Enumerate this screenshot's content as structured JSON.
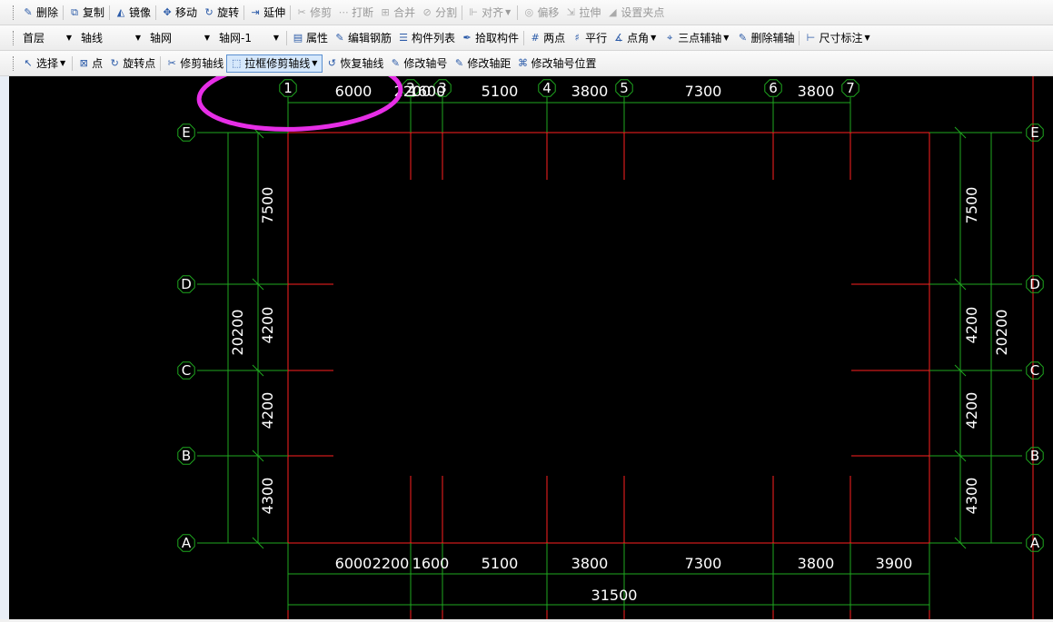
{
  "toolbar1": [
    {
      "name": "delete-button",
      "icon": "pencil-erase-icon",
      "label": "删除",
      "disabled": false
    },
    {
      "name": "copy-button",
      "icon": "copy-icon",
      "label": "复制",
      "disabled": false
    },
    {
      "name": "mirror-button",
      "icon": "mirror-icon",
      "label": "镜像",
      "disabled": false
    },
    {
      "name": "move-button",
      "icon": "move-icon",
      "label": "移动",
      "disabled": false
    },
    {
      "name": "rotate-button",
      "icon": "rotate-icon",
      "label": "旋转",
      "disabled": false
    },
    {
      "name": "extend-button",
      "icon": "extend-icon",
      "label": "延伸",
      "disabled": false
    },
    {
      "name": "trim-button",
      "icon": "trim-icon",
      "label": "修剪",
      "disabled": true
    },
    {
      "name": "break-button",
      "icon": "break-icon",
      "label": "打断",
      "disabled": true
    },
    {
      "name": "merge-button",
      "icon": "merge-icon",
      "label": "合并",
      "disabled": true
    },
    {
      "name": "split-button",
      "icon": "split-icon",
      "label": "分割",
      "disabled": true
    },
    {
      "name": "align-button",
      "icon": "align-icon",
      "label": "对齐",
      "disabled": true,
      "dropdown": true
    },
    {
      "name": "offset-button",
      "icon": "offset-icon",
      "label": "偏移",
      "disabled": true
    },
    {
      "name": "stretch-button",
      "icon": "stretch-icon",
      "label": "拉伸",
      "disabled": true
    },
    {
      "name": "set-grip-button",
      "icon": "grip-icon",
      "label": "设置夹点",
      "disabled": true
    }
  ],
  "toolbar2": {
    "floor": "首层",
    "category": "轴线",
    "type": "轴网",
    "instance": "轴网-1",
    "buttons": [
      {
        "name": "properties-button",
        "icon": "properties-icon",
        "label": "属性"
      },
      {
        "name": "edit-rebar-button",
        "icon": "edit-rebar-icon",
        "label": "编辑钢筋"
      },
      {
        "name": "component-list-button",
        "icon": "list-icon",
        "label": "构件列表"
      },
      {
        "name": "pick-component-button",
        "icon": "eyedropper-icon",
        "label": "拾取构件"
      },
      {
        "name": "two-point-button",
        "icon": "two-point-axis-icon",
        "label": "两点"
      },
      {
        "name": "parallel-button",
        "icon": "parallel-axis-icon",
        "label": "平行"
      },
      {
        "name": "point-angle-button",
        "icon": "point-angle-icon",
        "label": "点角",
        "dropdown": true
      },
      {
        "name": "three-point-aux-button",
        "icon": "three-point-axis-icon",
        "label": "三点辅轴",
        "dropdown": true
      },
      {
        "name": "delete-aux-button",
        "icon": "delete-aux-icon",
        "label": "删除辅轴"
      },
      {
        "name": "dimension-button",
        "icon": "dimension-icon",
        "label": "尺寸标注",
        "dropdown": true
      }
    ]
  },
  "toolbar3": [
    {
      "name": "select-button",
      "icon": "cursor-icon",
      "label": "选择",
      "dropdown": true,
      "active": false
    },
    {
      "name": "point-button",
      "icon": "point-box-icon",
      "label": "点",
      "active": false
    },
    {
      "name": "rotate-point-button",
      "icon": "rotate-point-icon",
      "label": "旋转点",
      "active": false
    },
    {
      "name": "trim-axis-button",
      "icon": "trim-axis-icon",
      "label": "修剪轴线",
      "active": false
    },
    {
      "name": "box-trim-axis-button",
      "icon": "box-trim-axis-icon",
      "label": "拉框修剪轴线",
      "dropdown": true,
      "active": true
    },
    {
      "name": "restore-axis-button",
      "icon": "restore-axis-icon",
      "label": "恢复轴线",
      "active": false
    },
    {
      "name": "edit-axis-number-button",
      "icon": "edit-axis-number-icon",
      "label": "修改轴号",
      "active": false
    },
    {
      "name": "edit-axis-distance-button",
      "icon": "edit-axis-distance-icon",
      "label": "修改轴距",
      "active": false
    },
    {
      "name": "edit-axis-position-button",
      "icon": "edit-axis-position-icon",
      "label": "修改轴号位置",
      "active": false
    }
  ],
  "grid": {
    "x_axes": [
      "1",
      "2",
      "3",
      "4",
      "5",
      "6",
      "7"
    ],
    "y_axes": [
      "E",
      "D",
      "C",
      "B",
      "A"
    ],
    "top_dims": [
      "6000",
      "2200",
      "1600",
      "5100",
      "3800",
      "7300",
      "3800"
    ],
    "bottom_dims": [
      "6000",
      "2200",
      "1600",
      "5100",
      "3800",
      "7300",
      "3800",
      "3900"
    ],
    "bottom_total": "31500",
    "left_dims": [
      "7500",
      "4200",
      "4200",
      "4300"
    ],
    "left_total": "20200",
    "right_dims": [
      "7500",
      "4200",
      "4200",
      "4300"
    ],
    "right_total": "20200"
  },
  "colors": {
    "canvas": "#000000",
    "axis_line": "#ff2020",
    "dim_line": "#1fa81f",
    "text": "#ffffff",
    "highlight": "#e62ee6"
  }
}
